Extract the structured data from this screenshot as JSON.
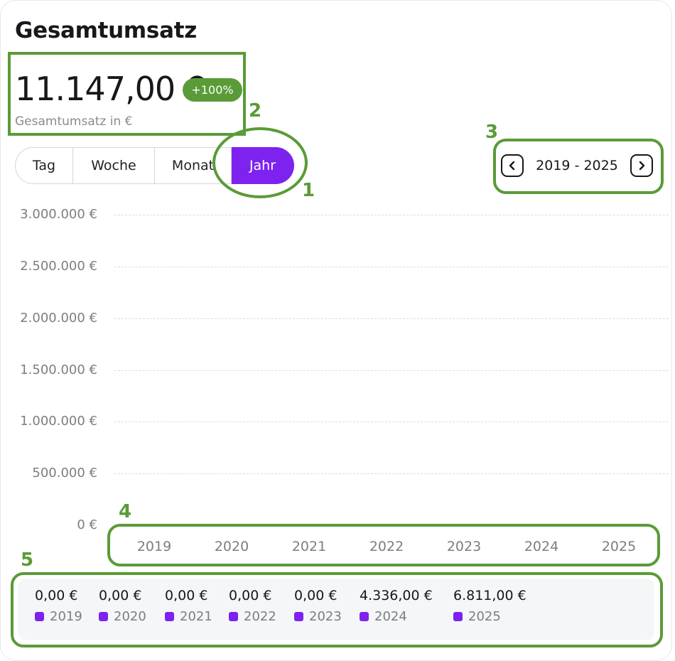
{
  "header": {
    "title": "Gesamtumsatz",
    "total": "11.147,00 €",
    "badge": "+100%",
    "subtitle": "Gesamtumsatz in €"
  },
  "period_tabs": [
    {
      "label": "Tag",
      "active": false
    },
    {
      "label": "Woche",
      "active": false
    },
    {
      "label": "Monat",
      "active": false
    },
    {
      "label": "Jahr",
      "active": true
    }
  ],
  "range": {
    "label": "2019 - 2025",
    "prev_icon": "chevron-left-icon",
    "next_icon": "chevron-right-icon"
  },
  "colors": {
    "accent": "#7e22f0",
    "badge": "#5a9b37",
    "annotation": "#5a9b37"
  },
  "chart_data": {
    "type": "bar",
    "categories": [
      "2019",
      "2020",
      "2021",
      "2022",
      "2023",
      "2024",
      "2025"
    ],
    "values": [
      0,
      0,
      0,
      0,
      0,
      4336,
      6811
    ],
    "ylim": [
      0,
      3000000
    ],
    "yticks": [
      "0 €",
      "500.000 €",
      "1.000.000 €",
      "1.500.000 €",
      "2.000.000 €",
      "2.500.000 €",
      "3.000.000 €"
    ],
    "grid": true
  },
  "legend": [
    {
      "value": "0,00 €",
      "year": "2019"
    },
    {
      "value": "0,00 €",
      "year": "2020"
    },
    {
      "value": "0,00 €",
      "year": "2021"
    },
    {
      "value": "0,00 €",
      "year": "2022"
    },
    {
      "value": "0,00 €",
      "year": "2023"
    },
    {
      "value": "4.336,00 €",
      "year": "2024"
    },
    {
      "value": "6.811,00 €",
      "year": "2025"
    }
  ],
  "annotations": [
    "1",
    "2",
    "3",
    "4",
    "5"
  ]
}
